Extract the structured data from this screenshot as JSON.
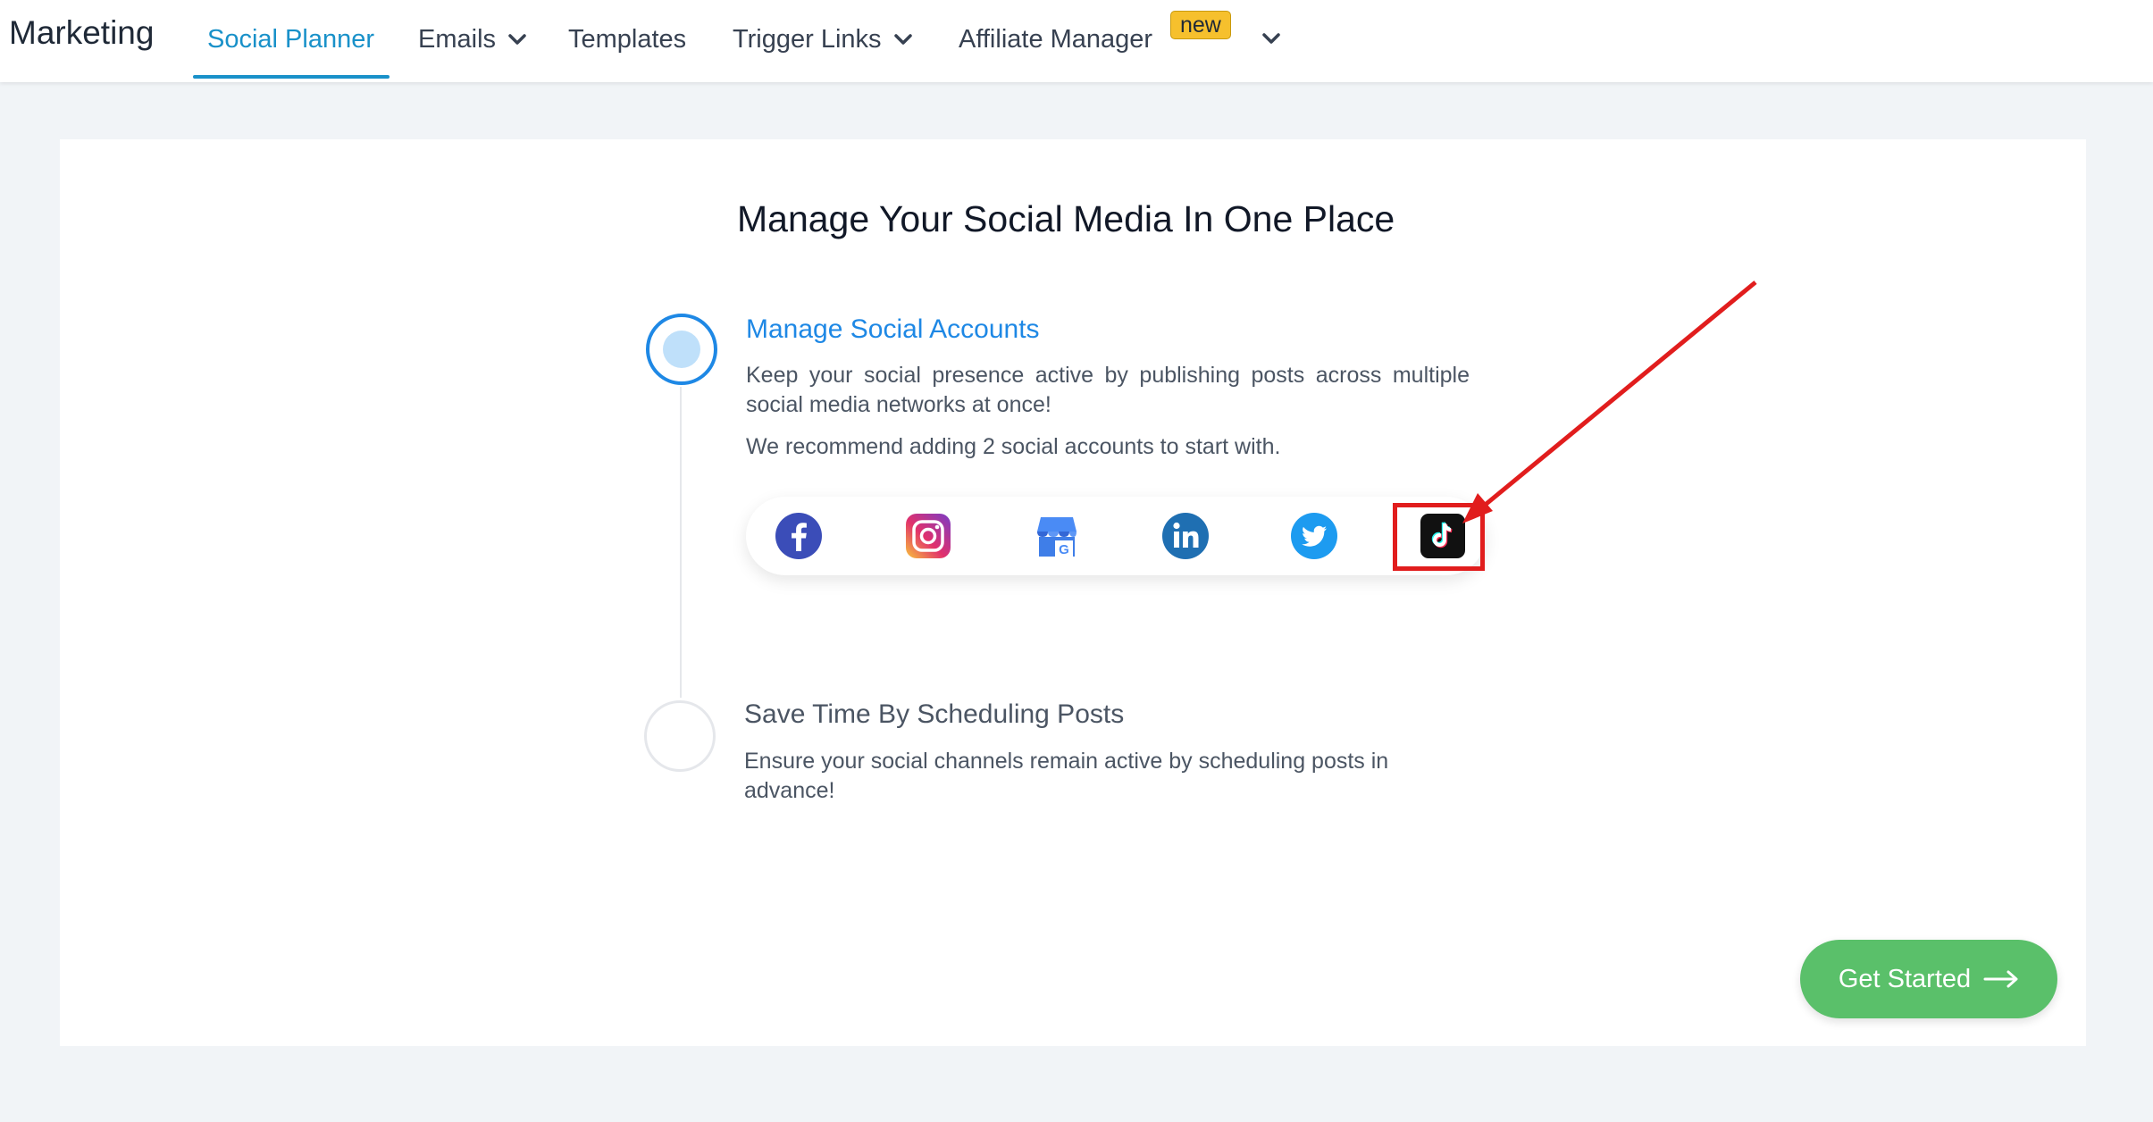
{
  "nav": {
    "brand": "Marketing",
    "items": [
      {
        "label": "Social Planner",
        "active": true
      },
      {
        "label": "Emails",
        "dropdown": true
      },
      {
        "label": "Templates"
      },
      {
        "label": "Trigger Links",
        "dropdown": true
      },
      {
        "label": "Affiliate Manager"
      }
    ],
    "badge_new": "new",
    "more_icon": "chevron-down-icon"
  },
  "main": {
    "title": "Manage Your Social Media In One Place",
    "steps": [
      {
        "title": "Manage Social Accounts",
        "description": "Keep your social presence active by publishing posts across multiple social media networks at once!",
        "recommendation": "We recommend adding 2 social accounts to start with.",
        "active": true
      },
      {
        "title": "Save Time By Scheduling Posts",
        "description": "Ensure your social channels remain active by scheduling posts in advance!",
        "active": false
      }
    ],
    "social_icons": [
      "facebook-icon",
      "instagram-icon",
      "google-business-icon",
      "linkedin-icon",
      "twitter-icon",
      "tiktok-icon"
    ],
    "highlighted": "tiktok-icon"
  },
  "cta": {
    "label": "Get Started",
    "icon": "arrow-right-icon"
  },
  "colors": {
    "accent": "#1991c9",
    "step_active": "#1e88e5",
    "cta": "#5ac06a",
    "badge": "#f6c02d",
    "annotation": "#e11d1d"
  }
}
